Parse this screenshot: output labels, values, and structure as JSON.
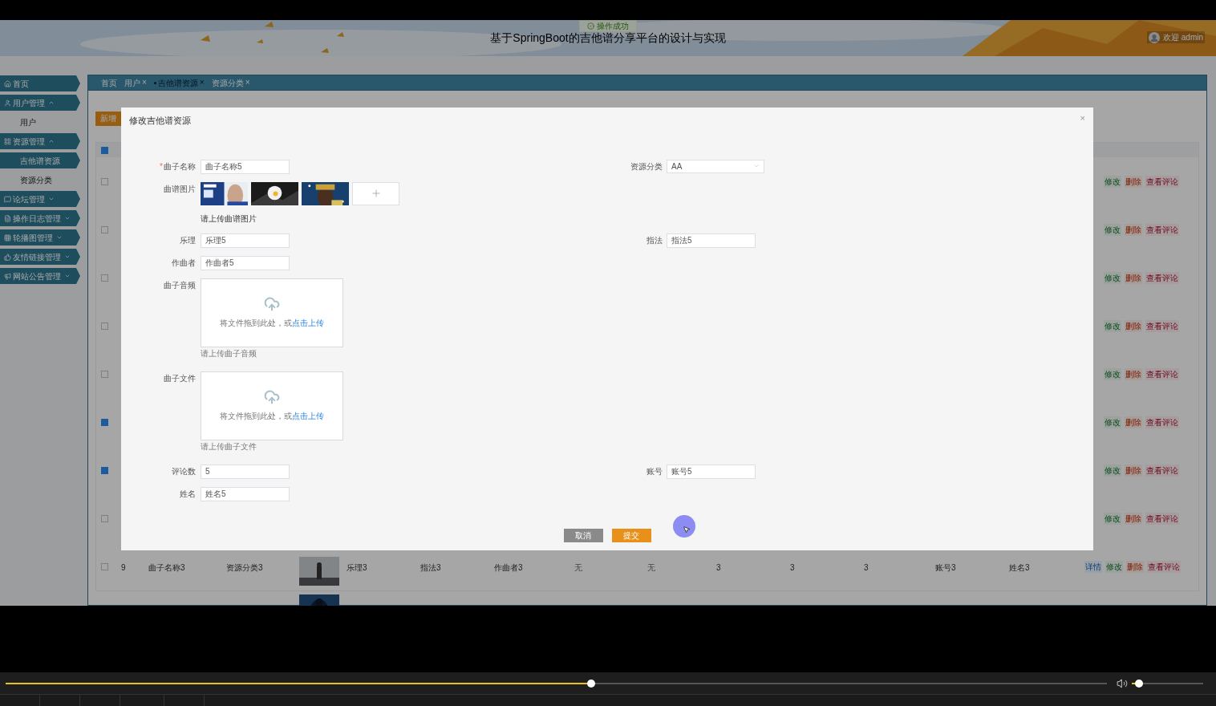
{
  "header": {
    "title": "基于SpringBoot的吉他谱分享平台的设计与实现",
    "toast": "操作成功",
    "user": "欢迎 admin"
  },
  "sidebar": {
    "items": [
      {
        "label": "首页"
      },
      {
        "label": "用户管理",
        "expanded": true,
        "children": [
          {
            "label": "用户",
            "selected": false
          }
        ]
      },
      {
        "label": "资源管理",
        "expanded": true,
        "children": [
          {
            "label": "吉他谱资源",
            "selected": true
          },
          {
            "label": "资源分类",
            "selected": false
          }
        ]
      },
      {
        "label": "论坛管理",
        "expanded": false
      },
      {
        "label": "操作日志管理",
        "expanded": false
      },
      {
        "label": "轮播图管理",
        "expanded": false
      },
      {
        "label": "友情链接管理",
        "expanded": false
      },
      {
        "label": "网站公告管理",
        "expanded": false
      }
    ]
  },
  "tabs": [
    {
      "label": "首页",
      "selected": false
    },
    {
      "label": "用户",
      "selected": false,
      "close": "×"
    },
    {
      "label": "吉他谱资源",
      "selected": true,
      "close": "×"
    },
    {
      "label": "资源分类",
      "selected": false,
      "close": "×"
    }
  ],
  "add_button": "新增",
  "table": {
    "header_checked": true,
    "rows": [
      {
        "checked": false,
        "actions": [
          {
            "label": "修改",
            "kind": "edit"
          },
          {
            "label": "删除",
            "kind": "delete"
          },
          {
            "label": "查看评论",
            "kind": "comments"
          }
        ]
      },
      {
        "checked": false,
        "actions": [
          {
            "label": "修改",
            "kind": "edit"
          },
          {
            "label": "删除",
            "kind": "delete"
          },
          {
            "label": "查看评论",
            "kind": "comments"
          }
        ]
      },
      {
        "checked": false,
        "actions": [
          {
            "label": "修改",
            "kind": "edit"
          },
          {
            "label": "删除",
            "kind": "delete"
          },
          {
            "label": "查看评论",
            "kind": "comments"
          }
        ]
      },
      {
        "checked": false,
        "actions": [
          {
            "label": "修改",
            "kind": "edit"
          },
          {
            "label": "删除",
            "kind": "delete"
          },
          {
            "label": "查看评论",
            "kind": "comments"
          }
        ]
      },
      {
        "checked": false,
        "actions": [
          {
            "label": "修改",
            "kind": "edit"
          },
          {
            "label": "删除",
            "kind": "delete"
          },
          {
            "label": "查看评论",
            "kind": "comments"
          }
        ]
      },
      {
        "checked": true,
        "actions": [
          {
            "label": "修改",
            "kind": "edit"
          },
          {
            "label": "删除",
            "kind": "delete"
          },
          {
            "label": "查看评论",
            "kind": "comments"
          }
        ]
      },
      {
        "checked": true,
        "actions": [
          {
            "label": "修改",
            "kind": "edit"
          },
          {
            "label": "删除",
            "kind": "delete"
          },
          {
            "label": "查看评论",
            "kind": "comments"
          }
        ]
      },
      {
        "checked": false,
        "actions": [
          {
            "label": "修改",
            "kind": "edit"
          },
          {
            "label": "删除",
            "kind": "delete"
          },
          {
            "label": "查看评论",
            "kind": "comments"
          }
        ]
      },
      {
        "checked": false,
        "cells": [
          {
            "kind": "text",
            "text": "9"
          },
          {
            "kind": "text",
            "text": "曲子名称3"
          },
          {
            "kind": "text",
            "text": "资源分类3"
          },
          {
            "kind": "pictures"
          },
          {
            "kind": "text",
            "text": "乐理3"
          },
          {
            "kind": "text",
            "text": "指法3"
          },
          {
            "kind": "text",
            "text": "作曲者3"
          },
          {
            "kind": "muted",
            "text": "无"
          },
          {
            "kind": "muted",
            "text": "无"
          },
          {
            "kind": "text",
            "text": "3"
          },
          {
            "kind": "text",
            "text": "3"
          },
          {
            "kind": "text",
            "text": "3"
          },
          {
            "kind": "text",
            "text": "账号3"
          },
          {
            "kind": "text",
            "text": "姓名3"
          }
        ],
        "actions": [
          {
            "label": "详情",
            "kind": "detail"
          },
          {
            "label": "修改",
            "kind": "edit"
          },
          {
            "label": "删除",
            "kind": "delete"
          },
          {
            "label": "查看评论",
            "kind": "comments"
          }
        ]
      }
    ]
  },
  "modal": {
    "title": "修改吉他谱资源",
    "close": "×",
    "rows": [
      {
        "left": {
          "kind": "text",
          "label": "曲子名称",
          "required_mark": "*",
          "value": "曲子名称5"
        },
        "right": {
          "kind": "select",
          "label": "资源分类",
          "value": "AA"
        }
      },
      {
        "left": {
          "kind": "images",
          "label": "曲谱图片",
          "hint": "请上传曲谱图片"
        }
      },
      {
        "left": {
          "kind": "text",
          "label": "乐理",
          "value": "乐理5"
        },
        "right": {
          "kind": "text",
          "label": "指法",
          "value": "指法5"
        }
      },
      {
        "left": {
          "kind": "text",
          "label": "作曲者",
          "value": "作曲者5"
        }
      },
      {
        "left": {
          "kind": "upload",
          "label": "曲子音频",
          "prompt": "将文件拖到此处，或",
          "link": "点击上传",
          "hint": "请上传曲子音频"
        }
      },
      {
        "left": {
          "kind": "upload",
          "label": "曲子文件",
          "prompt": "将文件拖到此处，或",
          "link": "点击上传",
          "hint": "请上传曲子文件"
        }
      },
      {
        "left": {
          "kind": "text",
          "label": "评论数",
          "value": "5"
        },
        "right": {
          "kind": "text",
          "label": "账号",
          "value": "账号5"
        }
      },
      {
        "left": {
          "kind": "text",
          "label": "姓名",
          "value": "姓名5"
        }
      }
    ],
    "buttons": [
      {
        "label": "取消",
        "kind": "cancel"
      },
      {
        "label": "提交",
        "kind": "submit"
      }
    ]
  },
  "player": {
    "progress": {
      "level": 0.532
    },
    "volume": {
      "level": 0.1
    }
  }
}
